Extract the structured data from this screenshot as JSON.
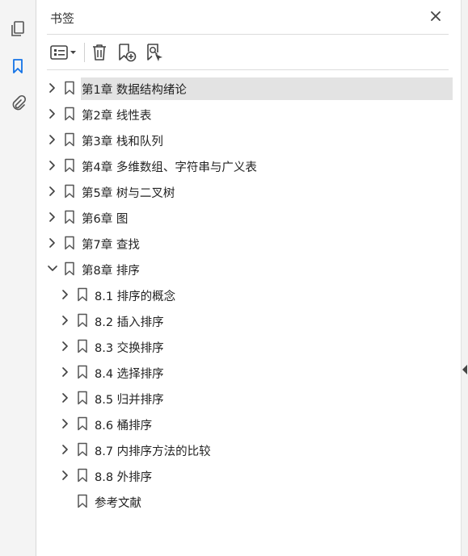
{
  "panel": {
    "title": "书签"
  },
  "bookmarks": [
    {
      "label": "第1章 数据结构绪论",
      "level": 0,
      "expanded": false,
      "has_children": true,
      "selected": true
    },
    {
      "label": "第2章 线性表",
      "level": 0,
      "expanded": false,
      "has_children": true
    },
    {
      "label": "第3章 栈和队列",
      "level": 0,
      "expanded": false,
      "has_children": true
    },
    {
      "label": "第4章 多维数组、字符串与广义表",
      "level": 0,
      "expanded": false,
      "has_children": true
    },
    {
      "label": "第5章 树与二叉树",
      "level": 0,
      "expanded": false,
      "has_children": true
    },
    {
      "label": "第6章 图",
      "level": 0,
      "expanded": false,
      "has_children": true
    },
    {
      "label": "第7章 查找",
      "level": 0,
      "expanded": false,
      "has_children": true
    },
    {
      "label": "第8章 排序",
      "level": 0,
      "expanded": true,
      "has_children": true
    },
    {
      "label": "8.1 排序的概念",
      "level": 1,
      "expanded": false,
      "has_children": true
    },
    {
      "label": "8.2 插入排序",
      "level": 1,
      "expanded": false,
      "has_children": true
    },
    {
      "label": "8.3 交换排序",
      "level": 1,
      "expanded": false,
      "has_children": true
    },
    {
      "label": "8.4 选择排序",
      "level": 1,
      "expanded": false,
      "has_children": true
    },
    {
      "label": "8.5 归并排序",
      "level": 1,
      "expanded": false,
      "has_children": true
    },
    {
      "label": "8.6 桶排序",
      "level": 1,
      "expanded": false,
      "has_children": true
    },
    {
      "label": "8.7 内排序方法的比较",
      "level": 1,
      "expanded": false,
      "has_children": true
    },
    {
      "label": "8.8 外排序",
      "level": 1,
      "expanded": false,
      "has_children": true
    },
    {
      "label": "参考文献",
      "level": 1,
      "expanded": false,
      "has_children": false
    }
  ],
  "colors": {
    "accent": "#1473e6",
    "selected_bg": "#e3e3e3",
    "icon": "#555555"
  }
}
